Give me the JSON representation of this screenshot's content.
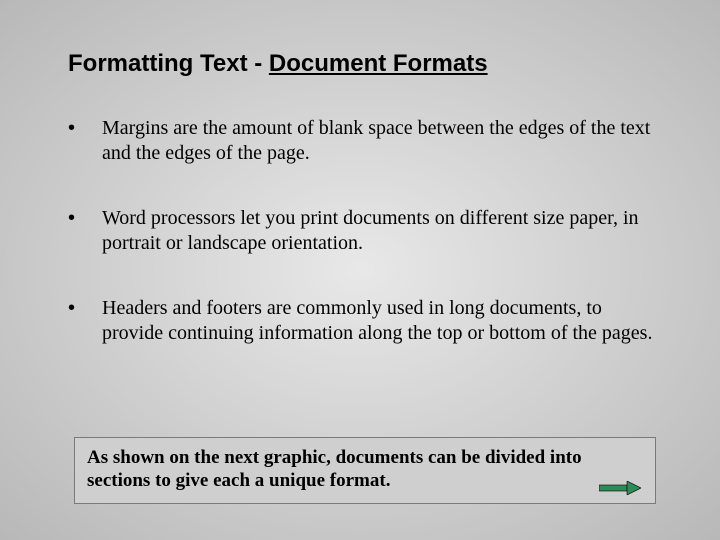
{
  "title": {
    "prefix": "Formatting Text - ",
    "underlined": "Document Formats"
  },
  "bullets": [
    "Margins are the amount of blank space between the edges of the text and the edges of the page.",
    "Word processors let you print documents on different size paper, in portrait or landscape orientation.",
    "Headers and footers are commonly used in long documents, to provide continuing information along the top or bottom of the pages."
  ],
  "callout": "As shown on the next graphic, documents can be divided into sections to give each a unique format.",
  "arrow_color": "#2e8b57"
}
